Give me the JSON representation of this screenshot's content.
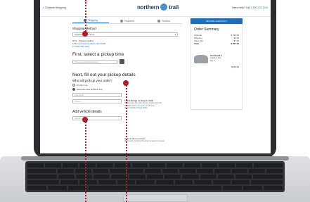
{
  "header": {
    "back_label": "< Continue Shopping",
    "logo_text": "northern",
    "logo_text_2": "trail",
    "help_prefix": "Need Help? Call",
    "help_phone": "1.800.123.1234"
  },
  "tabs": [
    {
      "label": "Shipping",
      "active": true
    },
    {
      "label": "Payment",
      "active": false
    },
    {
      "label": "Review",
      "active": false
    }
  ],
  "shipping": {
    "heading": "Shipping Method",
    "method_value": "Ordered Pickup (0.0)",
    "store_name": "NTC - Portland Gallery",
    "store_address": "1234 Northtrail Portland, OR 97205",
    "store_phone": "(503) 555-1234"
  },
  "pickup_time": {
    "heading": "First, select a pickup time",
    "placeholder": "Choose a pickup window"
  },
  "details": {
    "heading": "Next, fill out your pickup details",
    "who_heading": "Who will pick up your order?",
    "option_1": "I'll pick it up",
    "option_2": "Someone else will pick it up",
    "name_placeholder": "Full name",
    "phone_placeholder": "Phone *",
    "vehicle_heading": "Add vehicle details",
    "vehicle_placeholder": "Vehicle"
  },
  "info_box": {
    "title": "Leave things to keep in mind",
    "line_1": "Please have the order ID and a valid photo ID",
    "line_2": "available when you arrive at the store.",
    "link": "View Curbside Pickup Policy"
  },
  "help_find": {
    "title": "Help us find you faster",
    "line": "We'll reach out when the order is ready for pickup."
  },
  "summary": {
    "checkout_label": "SECURE CHECKOUT",
    "title": "Order Summary",
    "rows": [
      {
        "label": "Subtotal",
        "value": "$ 249.99"
      },
      {
        "label": "Shipping",
        "value": "$0.00"
      },
      {
        "label": "Sales Tax",
        "value": "$7.50"
      },
      {
        "label": "Total",
        "value": "$ 257.49"
      }
    ],
    "item_name": "Stormbreak 2",
    "item_desc": "2 person tent",
    "item_qty": "Qty: 1",
    "item_price": "$249.99"
  },
  "colors": {
    "accent": "#1d6fb8",
    "marker": "#b01d2a",
    "laptop_bezel": "#2b2d31"
  }
}
